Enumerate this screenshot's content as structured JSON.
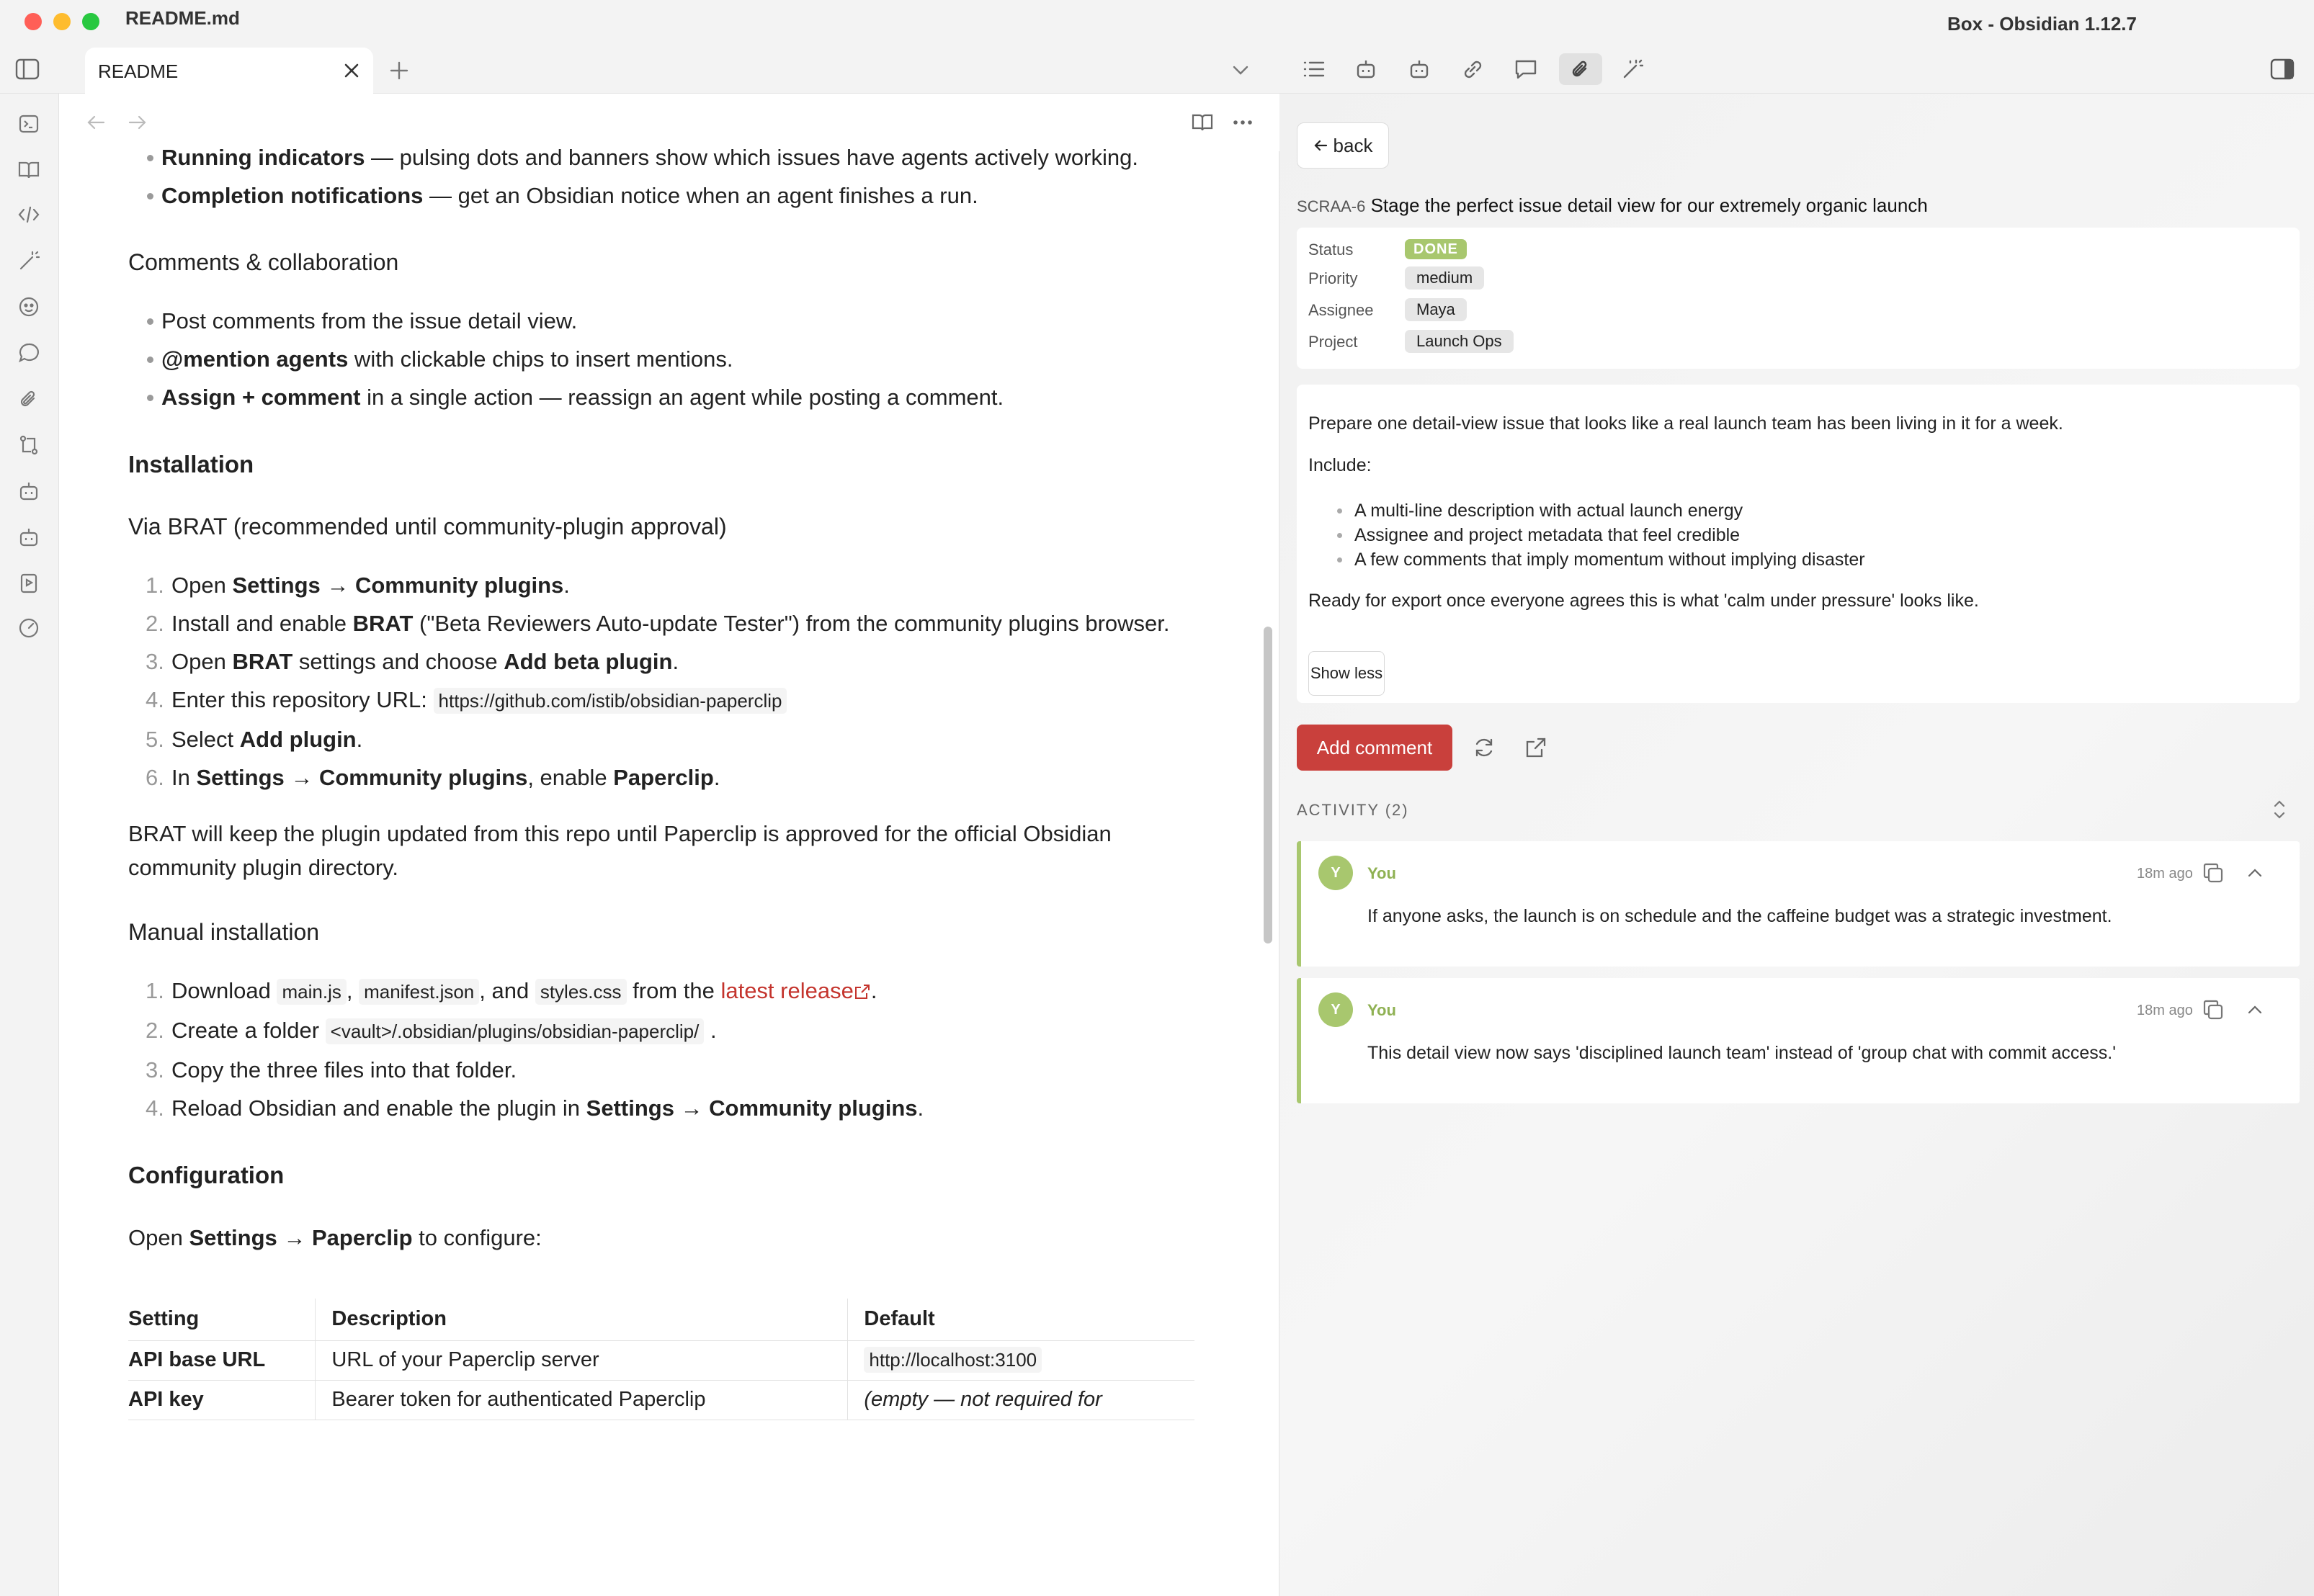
{
  "window": {
    "document_title": "README.md",
    "app_title": "Box - Obsidian 1.12.7"
  },
  "tabs": {
    "active": {
      "label": "README"
    }
  },
  "editor": {
    "sections": {
      "running_indicators": {
        "bold": "Running indicators",
        "text": " — pulsing dots and banners show which issues have agents actively working."
      },
      "completion_notifications": {
        "bold": "Completion notifications",
        "text": " — get an Obsidian notice when an agent finishes a run."
      },
      "comments_heading": "Comments & collaboration",
      "comments_items": {
        "post": "Post comments from the issue detail view.",
        "mention_bold": "@mention agents",
        "mention_text": " with clickable chips to insert mentions.",
        "assign_bold": "Assign + comment",
        "assign_text": " in a single action — reassign an agent while posting a comment."
      },
      "installation_heading": "Installation",
      "brat_heading": "Via BRAT (recommended until community-plugin approval)",
      "brat_steps": {
        "s1_pre": "Open ",
        "s1_bold": "Settings → Community plugins",
        "s1_post": ".",
        "s2_pre": "Install and enable ",
        "s2_bold": "BRAT",
        "s2_post": " (\"Beta Reviewers Auto-update Tester\") from the community plugins browser.",
        "s3_pre": "Open ",
        "s3_bold1": "BRAT",
        "s3_mid": " settings and choose ",
        "s3_bold2": "Add beta plugin",
        "s3_post": ".",
        "s4_pre": "Enter this repository URL: ",
        "s4_code": "https://github.com/istib/obsidian-paperclip",
        "s5_pre": "Select ",
        "s5_bold": "Add plugin",
        "s5_post": ".",
        "s6_pre": "In ",
        "s6_bold1": "Settings → Community plugins",
        "s6_mid": ", enable ",
        "s6_bold2": "Paperclip",
        "s6_post": "."
      },
      "brat_note": "BRAT will keep the plugin updated from this repo until Paperclip is approved for the official Obsidian community plugin directory.",
      "manual_heading": "Manual installation",
      "manual_steps": {
        "m1_pre": "Download ",
        "m1_code1": "main.js",
        "m1_sep1": ", ",
        "m1_code2": "manifest.json",
        "m1_sep2": ", and ",
        "m1_code3": "styles.css",
        "m1_mid": " from the ",
        "m1_link": "latest release",
        "m1_post": ".",
        "m2_pre": "Create a folder ",
        "m2_code": "<vault>/.obsidian/plugins/obsidian-paperclip/",
        "m2_post": " .",
        "m3": "Copy the three files into that folder.",
        "m4_pre": "Reload Obsidian and enable the plugin in ",
        "m4_bold": "Settings → Community plugins",
        "m4_post": "."
      },
      "configuration_heading": "Configuration",
      "config_intro_pre": "Open ",
      "config_intro_bold": "Settings → Paperclip",
      "config_intro_post": " to configure:",
      "config_table": {
        "headers": [
          "Setting",
          "Description",
          "Default"
        ],
        "rows": [
          [
            "API base URL",
            "URL of your Paperclip server",
            "http://localhost:3100"
          ],
          [
            "API key",
            "Bearer token for authenticated Paperclip",
            "(empty — not required for"
          ]
        ]
      }
    }
  },
  "panel": {
    "back_label": "back",
    "issue": {
      "id": "SCRAA-6",
      "title": "Stage the perfect issue detail view for our extremely organic launch",
      "meta": {
        "status_label": "Status",
        "status_value": "DONE",
        "priority_label": "Priority",
        "priority_value": "medium",
        "assignee_label": "Assignee",
        "assignee_value": "Maya",
        "project_label": "Project",
        "project_value": "Launch Ops"
      },
      "description": {
        "p1": "Prepare one detail-view issue that looks like a real launch team has been living in it for a week.",
        "p2": "Include:",
        "items": [
          "A multi-line description with actual launch energy",
          "Assignee and project metadata that feel credible",
          "A few comments that imply momentum without implying disaster"
        ],
        "p3": "Ready for export once everyone agrees this is what 'calm under pressure' looks like.",
        "show_less": "Show less"
      }
    },
    "add_comment_label": "Add comment",
    "activity_label": "ACTIVITY (2)",
    "comments": [
      {
        "avatar": "Y",
        "author": "You",
        "time": "18m ago",
        "body": "If anyone asks, the launch is on schedule and the caffeine budget was a strategic investment."
      },
      {
        "avatar": "Y",
        "author": "You",
        "time": "18m ago",
        "body": "This detail view now says 'disciplined launch team' instead of 'group chat with commit access.'"
      }
    ]
  },
  "colors": {
    "accent_red": "#c9403c",
    "status_green": "#a8c76e",
    "link_red": "#c4342d"
  },
  "icons": {
    "ribbon": [
      "terminal-icon",
      "book-icon",
      "code-icon",
      "magic-wand-icon",
      "bot-face-icon",
      "comment-icon",
      "paperclip-icon",
      "git-compare-icon",
      "robot-icon",
      "robot-icon",
      "slides-icon",
      "gauge-icon"
    ],
    "panel_tools": [
      "list-icon",
      "robot-icon",
      "robot-icon",
      "link-icon",
      "comment-icon",
      "paperclip-icon",
      "magic-wand-icon"
    ]
  }
}
